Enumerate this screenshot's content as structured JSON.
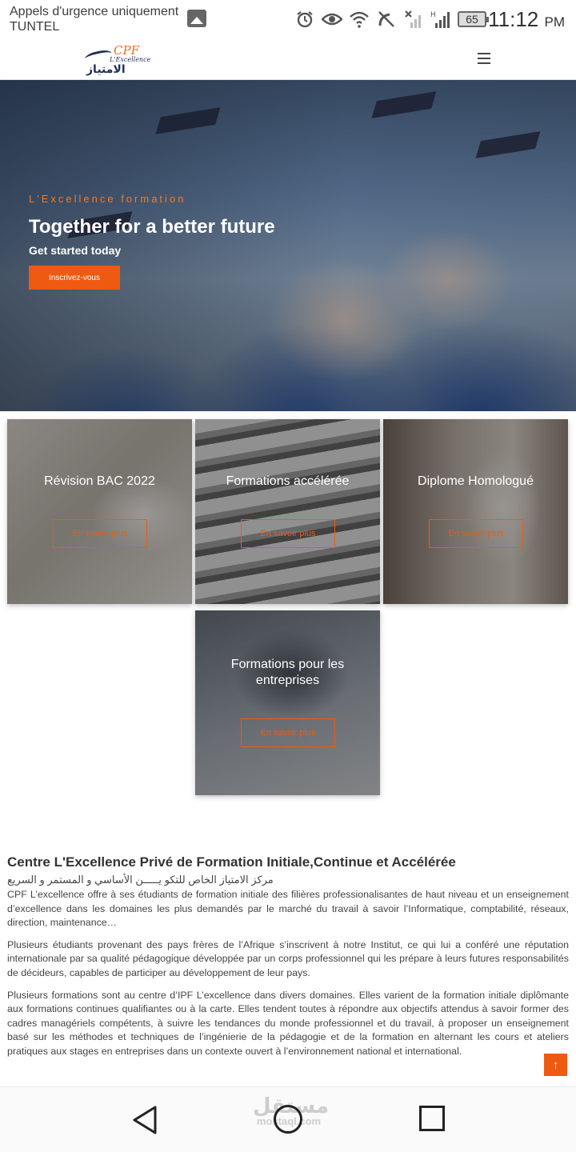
{
  "status_bar": {
    "line1": "Appels d'urgence uniquement",
    "line2": "TUNTEL",
    "battery": "65",
    "time": "11:12",
    "ampm": "PM",
    "icons": [
      "alarm-icon",
      "eye-icon",
      "wifi-icon",
      "no-call-icon",
      "no-signal-icon",
      "signal-icon"
    ]
  },
  "header": {
    "logo_cpf": "CPF",
    "logo_excellence": "L'Excellence",
    "logo_arabic": "الامتياز"
  },
  "hero": {
    "kicker": "L'Excellence formation",
    "title": "Together for a better future",
    "subtitle": "Get started today",
    "cta": "Inscrivez-vous"
  },
  "cards": [
    {
      "title": "Révision BAC 2022",
      "button": "En savoir plus"
    },
    {
      "title": "Formations accélérée",
      "button": "En savoir plus"
    },
    {
      "title": "Diplome Homologué",
      "button": "En savoir plus"
    },
    {
      "title": "Formations pour les entreprises",
      "button": "En savoir plus"
    }
  ],
  "about": {
    "title": "Centre L'Excellence Privé de Formation Initiale,Continue et Accélérée",
    "arabic": "مركز الامتياز الخاص للتكو يـــــن الأساسي و المستمر و السريع",
    "paragraphs": [
      "CPF L’excellence offre à ses étudiants de formation initiale des filières professionalisantes de haut niveau et un enseignement d’excellence dans les domaines les plus demandés par le marché du travail à savoir l’Informatique, comptabilité, réseaux, direction, maintenance…",
      "Plusieurs étudiants provenant des pays frères de l’Afrique s’inscrivent à notre Institut, ce qui lui a conféré une réputation internationale par sa qualité pédagogique développée par un corps professionnel qui les prépare à leurs futures responsabilités de décideurs, capables de participer au développement de leur pays.",
      "Plusieurs formations sont au centre d’IPF L’excellence dans divers domaines. Elles varient de la formation initiale diplômante aux formations continues qualifiantes ou à la carte. Elles tendent toutes à répondre aux objectifs attendus à savoir former des cadres managériels compétents, à suivre les tendances du monde professionnel et du travail, à proposer un enseignement basé sur les méthodes et techniques de l’ingénierie de la pédagogie et de la formation en alternant les cours et ateliers pratiques aux stages en entreprises dans un contexte ouvert à l’environnement national et international."
    ]
  },
  "watermark": {
    "arabic": "مستقل",
    "latin": "mostaql.com"
  },
  "colors": {
    "accent": "#ee5a12",
    "brand_navy": "#1c2e55"
  }
}
